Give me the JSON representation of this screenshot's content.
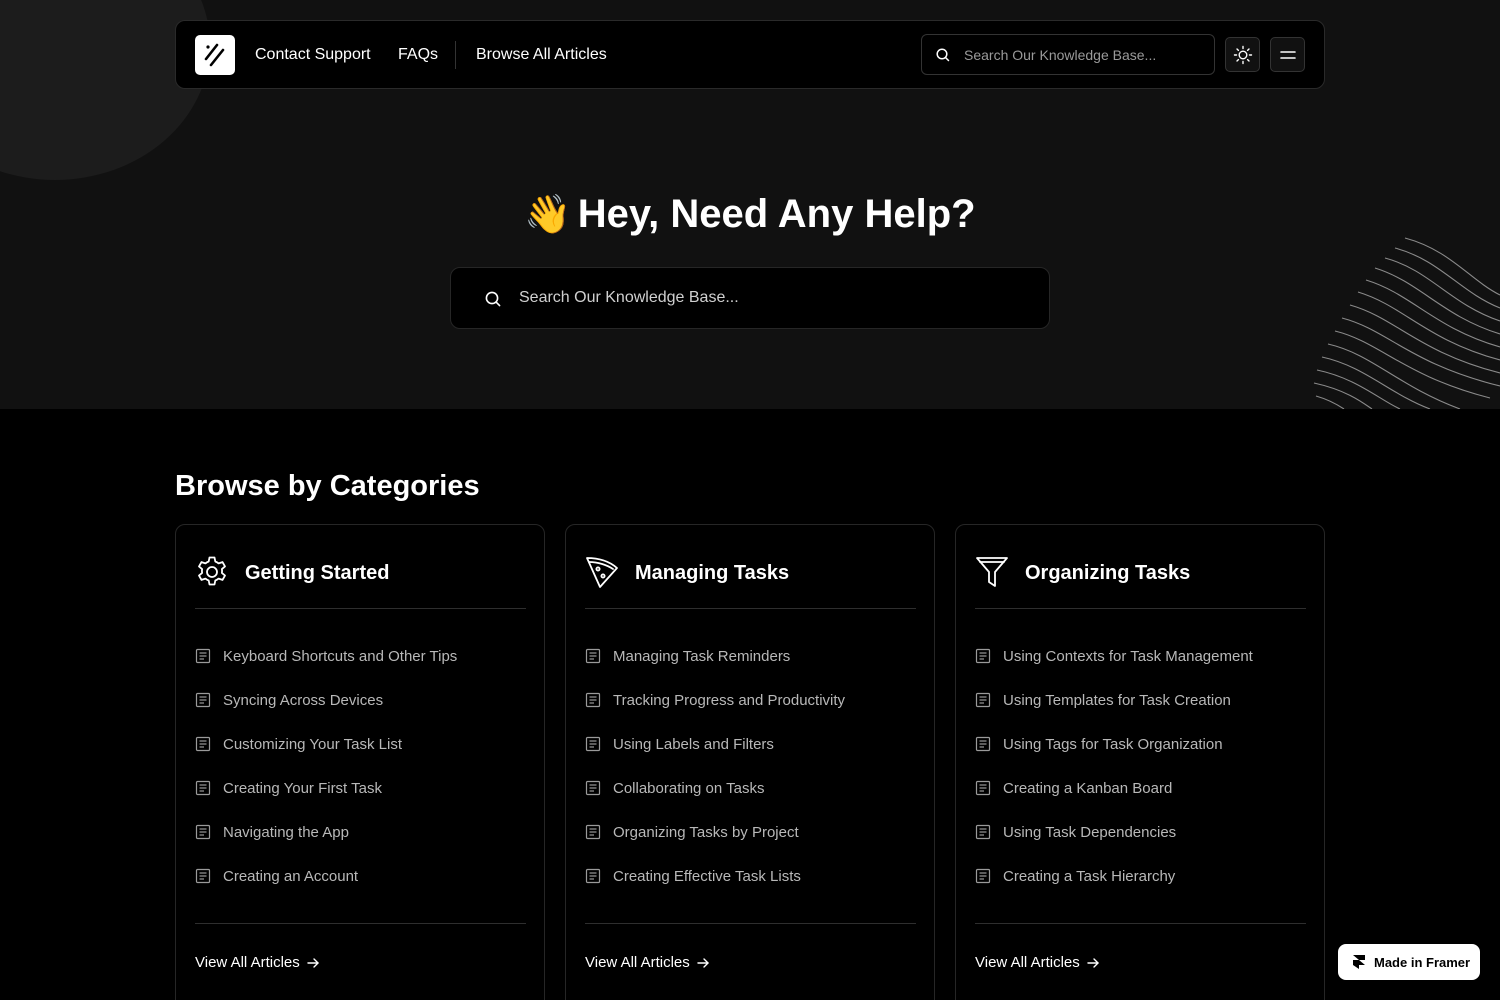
{
  "nav": {
    "links": [
      {
        "label": "Contact Support"
      },
      {
        "label": "FAQs"
      },
      {
        "label": "Browse All Articles"
      }
    ],
    "search_placeholder": "Search Our Knowledge Base...",
    "icons": {
      "logo": "logo-icon",
      "search": "search-icon",
      "theme": "sun-icon",
      "menu": "menu-icon"
    }
  },
  "hero": {
    "emoji": "👋",
    "title": "Hey, Need Any Help?",
    "search_placeholder": "Search Our Knowledge Base..."
  },
  "categories_section": {
    "title": "Browse by Categories",
    "categories": [
      {
        "title": "Getting Started",
        "icon": "gear-icon",
        "articles": [
          "Keyboard Shortcuts and Other Tips",
          "Syncing Across Devices",
          "Customizing Your Task List",
          "Creating Your First Task",
          "Navigating the App",
          "Creating an Account"
        ],
        "view_all": "View All Articles"
      },
      {
        "title": "Managing Tasks",
        "icon": "pizza-slice-icon",
        "articles": [
          "Managing Task Reminders",
          "Tracking Progress and Productivity",
          "Using Labels and Filters",
          "Collaborating on Tasks",
          "Organizing Tasks by Project",
          "Creating Effective Task Lists"
        ],
        "view_all": "View All Articles"
      },
      {
        "title": "Organizing Tasks",
        "icon": "filter-icon",
        "articles": [
          "Using Contexts for Task Management",
          "Using Templates for Task Creation",
          "Using Tags for Task Organization",
          "Creating a Kanban Board",
          "Using Task Dependencies",
          "Creating a Task Hierarchy"
        ],
        "view_all": "View All Articles"
      }
    ]
  },
  "badge": {
    "label": "Made in Framer",
    "icon": "framer-icon"
  },
  "colors": {
    "background": "#000000",
    "hero_background": "#111111",
    "text": "#ffffff",
    "muted_text": "#b8b8b8",
    "border": "#262626"
  }
}
